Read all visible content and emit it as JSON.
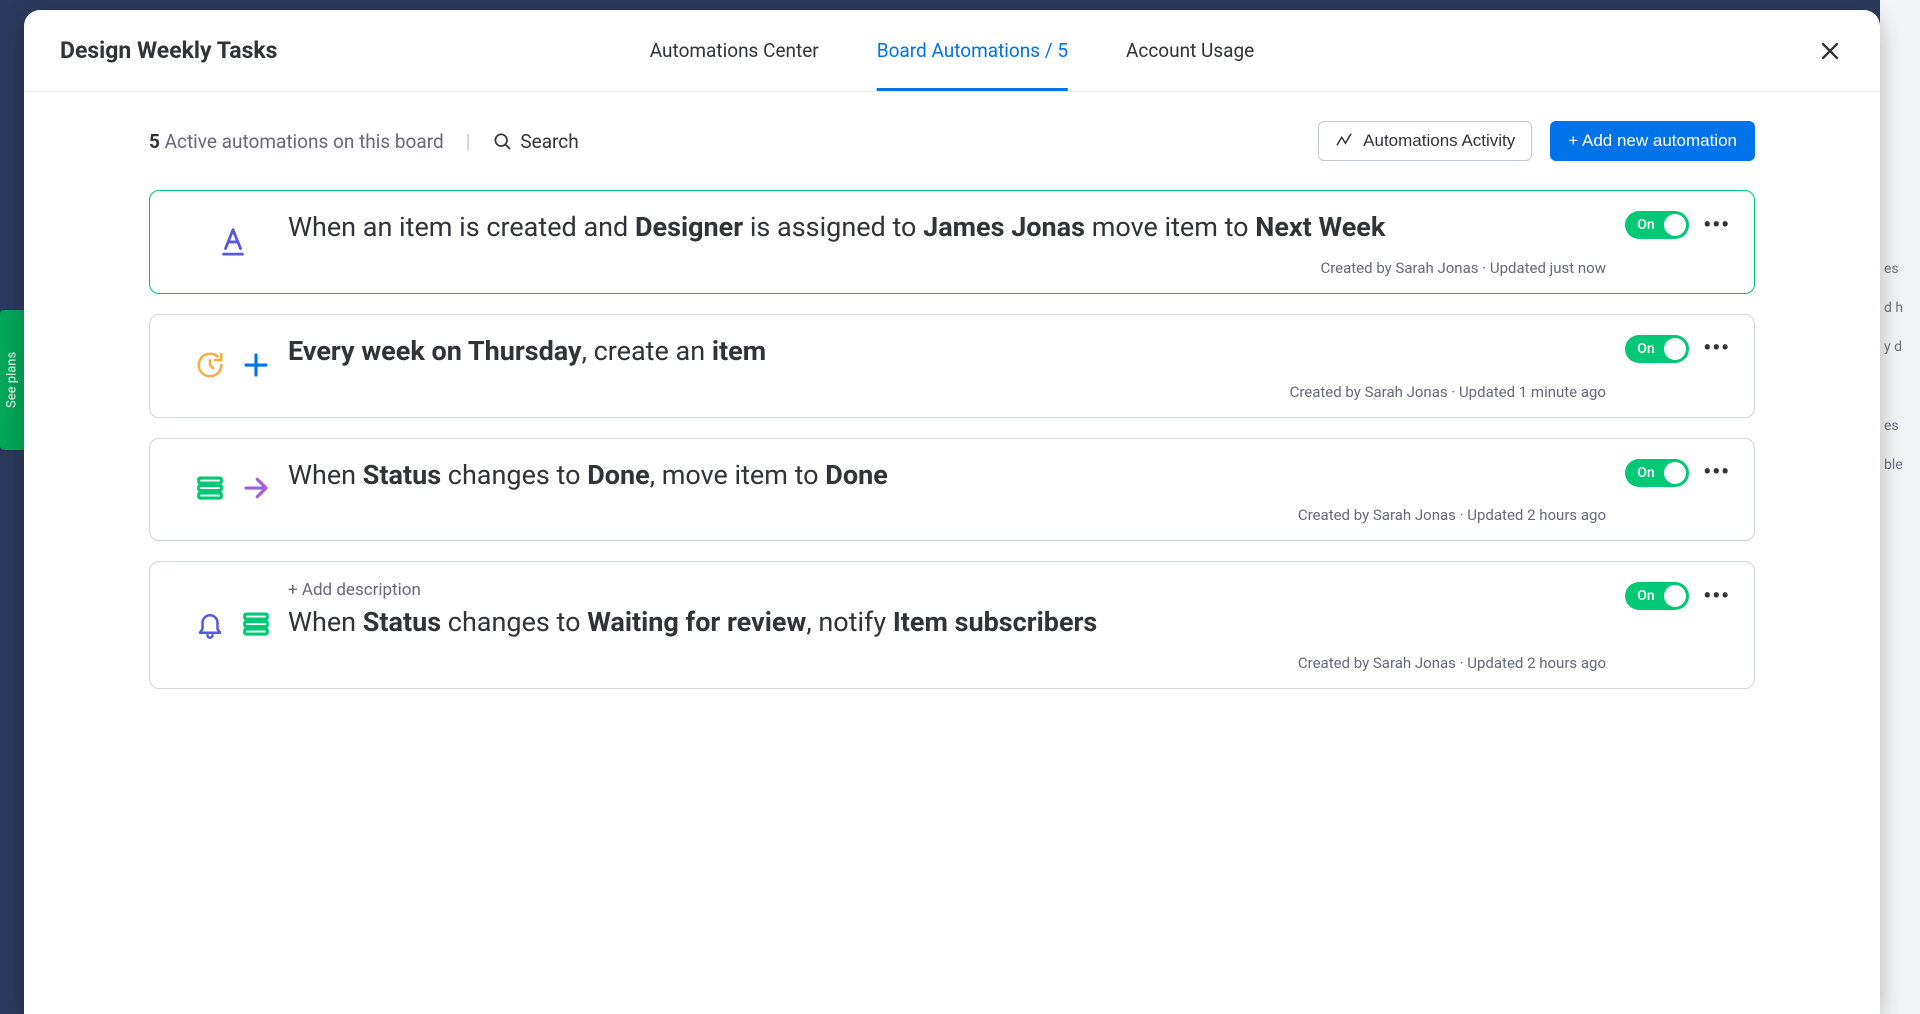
{
  "board_title": "Design Weekly Tasks",
  "tabs": {
    "center": "Automations Center",
    "board": "Board Automations / 5",
    "usage": "Account Usage"
  },
  "see_plans": "See plans",
  "toolbar": {
    "count": "5",
    "count_suffix": " Active automations on this board",
    "divider": "|",
    "search_label": "Search",
    "activity": "Automations Activity",
    "add": "+ Add new automation"
  },
  "toggle_label": "On",
  "more_label": "•••",
  "add_description": "+ Add description",
  "automations": [
    {
      "parts": [
        "When an item is created and ",
        "Designer",
        " is assigned to ",
        "James Jonas",
        " move item to ",
        "Next Week"
      ],
      "bold": [
        false,
        true,
        false,
        true,
        false,
        true
      ],
      "meta": "Created by Sarah Jonas · Updated just now",
      "highlight": true,
      "icons": [
        "underline-a"
      ]
    },
    {
      "parts": [
        "Every week on Thursday",
        ", create an ",
        "item"
      ],
      "bold": [
        true,
        false,
        true
      ],
      "meta": "Created by Sarah Jonas · Updated 1 minute ago",
      "highlight": false,
      "icons": [
        "clock-rotate",
        "plus-blue"
      ]
    },
    {
      "parts": [
        "When ",
        "Status",
        " changes to ",
        "Done",
        ", move item to ",
        "Done"
      ],
      "bold": [
        false,
        true,
        false,
        true,
        false,
        true
      ],
      "meta": "Created by Sarah Jonas · Updated 2 hours ago",
      "highlight": false,
      "icons": [
        "rows-green",
        "arrow-purple"
      ]
    },
    {
      "parts": [
        "When ",
        "Status",
        " changes to ",
        "Waiting for review",
        ", notify ",
        "Item subscribers"
      ],
      "bold": [
        false,
        true,
        false,
        true,
        false,
        true
      ],
      "meta": "Created by Sarah Jonas · Updated 2 hours ago",
      "highlight": false,
      "icons": [
        "bell",
        "rows-green"
      ],
      "add_description": true
    }
  ]
}
